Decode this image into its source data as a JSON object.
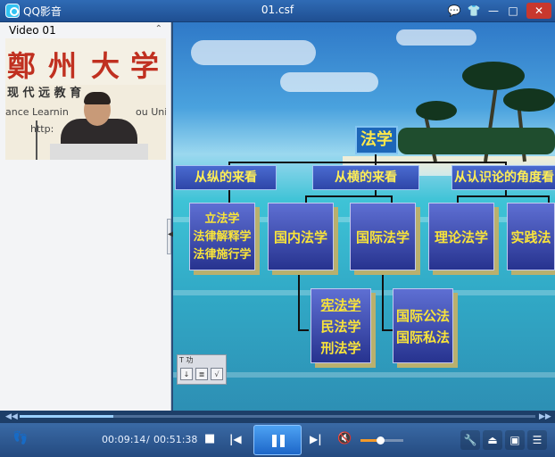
{
  "window": {
    "app_name": "QQ影音",
    "file_name": "01.csf",
    "buttons": {
      "chat": "💬",
      "skin": "👕",
      "minimize": "—",
      "maximize": "□",
      "close": "✕"
    }
  },
  "left_panel": {
    "title": "Video 01",
    "collapse_icon": "chevron-up-icon",
    "video_text": {
      "c1": "鄭",
      "c2": "州",
      "c3": "大",
      "c4": "学",
      "sub": "现 代 远     教 育",
      "line3": "ance Learnin",
      "line3b": "ou Uni",
      "line4": "http:"
    },
    "splitter_glyph": "◀"
  },
  "slide": {
    "root": "法学",
    "level1": [
      {
        "label": "从纵的来看"
      },
      {
        "label": "从横的来看"
      },
      {
        "label": "从认识论的角度看"
      }
    ],
    "boxes": {
      "vertical": [
        "立法学",
        "法律解释学",
        "法律施行学"
      ],
      "domestic": "国内法学",
      "international": "国际法学",
      "theory": "理论法学",
      "practice": "实践法",
      "domestic_sub": [
        "宪法学",
        "民法学",
        "刑法学"
      ],
      "international_sub": [
        "国际公法",
        "国际私法"
      ]
    },
    "mini_toolbar": {
      "title": "T 功",
      "btn1": "↓",
      "btn2": "≣",
      "btn3": "√"
    }
  },
  "seek": {
    "progress": 0.182,
    "prev": "◀◀",
    "next": "▶▶"
  },
  "controls": {
    "time_current": "00:09:14",
    "time_sep": "/",
    "time_total": "00:51:38",
    "stop": "■",
    "prev": "|◀",
    "next": "▶|",
    "mute": "🔇",
    "volume": 0.45,
    "settings": "🔧",
    "eject": "⏏",
    "screen": "▣",
    "playlist": "☰",
    "foot": "👣"
  },
  "colors": {
    "accent": "#1d66c8",
    "volume_fill": "#f39a2a",
    "slide_text": "#f8e33a"
  }
}
